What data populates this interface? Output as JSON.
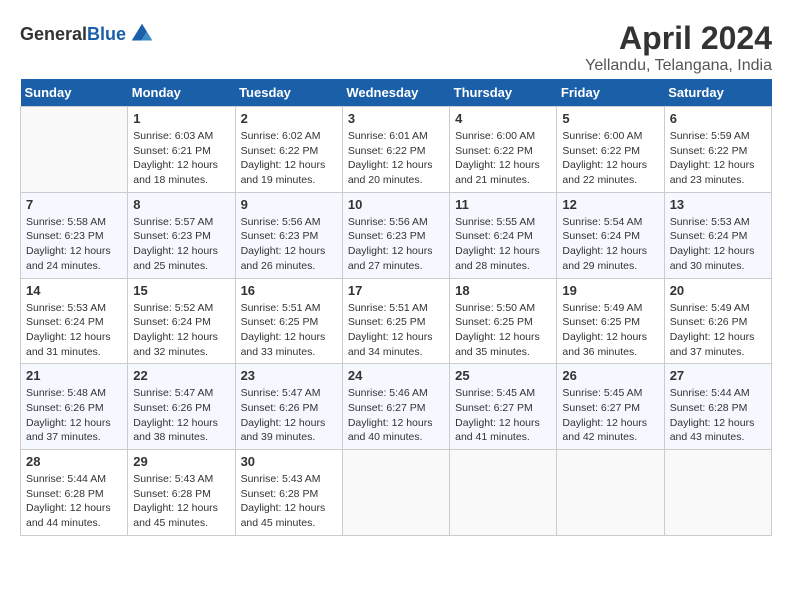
{
  "header": {
    "logo_general": "General",
    "logo_blue": "Blue",
    "month_title": "April 2024",
    "location": "Yellandu, Telangana, India"
  },
  "days_of_week": [
    "Sunday",
    "Monday",
    "Tuesday",
    "Wednesday",
    "Thursday",
    "Friday",
    "Saturday"
  ],
  "weeks": [
    [
      {
        "day": "",
        "empty": true
      },
      {
        "day": "1",
        "sunrise": "Sunrise: 6:03 AM",
        "sunset": "Sunset: 6:21 PM",
        "daylight": "Daylight: 12 hours and 18 minutes."
      },
      {
        "day": "2",
        "sunrise": "Sunrise: 6:02 AM",
        "sunset": "Sunset: 6:22 PM",
        "daylight": "Daylight: 12 hours and 19 minutes."
      },
      {
        "day": "3",
        "sunrise": "Sunrise: 6:01 AM",
        "sunset": "Sunset: 6:22 PM",
        "daylight": "Daylight: 12 hours and 20 minutes."
      },
      {
        "day": "4",
        "sunrise": "Sunrise: 6:00 AM",
        "sunset": "Sunset: 6:22 PM",
        "daylight": "Daylight: 12 hours and 21 minutes."
      },
      {
        "day": "5",
        "sunrise": "Sunrise: 6:00 AM",
        "sunset": "Sunset: 6:22 PM",
        "daylight": "Daylight: 12 hours and 22 minutes."
      },
      {
        "day": "6",
        "sunrise": "Sunrise: 5:59 AM",
        "sunset": "Sunset: 6:22 PM",
        "daylight": "Daylight: 12 hours and 23 minutes."
      }
    ],
    [
      {
        "day": "7",
        "sunrise": "Sunrise: 5:58 AM",
        "sunset": "Sunset: 6:23 PM",
        "daylight": "Daylight: 12 hours and 24 minutes."
      },
      {
        "day": "8",
        "sunrise": "Sunrise: 5:57 AM",
        "sunset": "Sunset: 6:23 PM",
        "daylight": "Daylight: 12 hours and 25 minutes."
      },
      {
        "day": "9",
        "sunrise": "Sunrise: 5:56 AM",
        "sunset": "Sunset: 6:23 PM",
        "daylight": "Daylight: 12 hours and 26 minutes."
      },
      {
        "day": "10",
        "sunrise": "Sunrise: 5:56 AM",
        "sunset": "Sunset: 6:23 PM",
        "daylight": "Daylight: 12 hours and 27 minutes."
      },
      {
        "day": "11",
        "sunrise": "Sunrise: 5:55 AM",
        "sunset": "Sunset: 6:24 PM",
        "daylight": "Daylight: 12 hours and 28 minutes."
      },
      {
        "day": "12",
        "sunrise": "Sunrise: 5:54 AM",
        "sunset": "Sunset: 6:24 PM",
        "daylight": "Daylight: 12 hours and 29 minutes."
      },
      {
        "day": "13",
        "sunrise": "Sunrise: 5:53 AM",
        "sunset": "Sunset: 6:24 PM",
        "daylight": "Daylight: 12 hours and 30 minutes."
      }
    ],
    [
      {
        "day": "14",
        "sunrise": "Sunrise: 5:53 AM",
        "sunset": "Sunset: 6:24 PM",
        "daylight": "Daylight: 12 hours and 31 minutes."
      },
      {
        "day": "15",
        "sunrise": "Sunrise: 5:52 AM",
        "sunset": "Sunset: 6:24 PM",
        "daylight": "Daylight: 12 hours and 32 minutes."
      },
      {
        "day": "16",
        "sunrise": "Sunrise: 5:51 AM",
        "sunset": "Sunset: 6:25 PM",
        "daylight": "Daylight: 12 hours and 33 minutes."
      },
      {
        "day": "17",
        "sunrise": "Sunrise: 5:51 AM",
        "sunset": "Sunset: 6:25 PM",
        "daylight": "Daylight: 12 hours and 34 minutes."
      },
      {
        "day": "18",
        "sunrise": "Sunrise: 5:50 AM",
        "sunset": "Sunset: 6:25 PM",
        "daylight": "Daylight: 12 hours and 35 minutes."
      },
      {
        "day": "19",
        "sunrise": "Sunrise: 5:49 AM",
        "sunset": "Sunset: 6:25 PM",
        "daylight": "Daylight: 12 hours and 36 minutes."
      },
      {
        "day": "20",
        "sunrise": "Sunrise: 5:49 AM",
        "sunset": "Sunset: 6:26 PM",
        "daylight": "Daylight: 12 hours and 37 minutes."
      }
    ],
    [
      {
        "day": "21",
        "sunrise": "Sunrise: 5:48 AM",
        "sunset": "Sunset: 6:26 PM",
        "daylight": "Daylight: 12 hours and 37 minutes."
      },
      {
        "day": "22",
        "sunrise": "Sunrise: 5:47 AM",
        "sunset": "Sunset: 6:26 PM",
        "daylight": "Daylight: 12 hours and 38 minutes."
      },
      {
        "day": "23",
        "sunrise": "Sunrise: 5:47 AM",
        "sunset": "Sunset: 6:26 PM",
        "daylight": "Daylight: 12 hours and 39 minutes."
      },
      {
        "day": "24",
        "sunrise": "Sunrise: 5:46 AM",
        "sunset": "Sunset: 6:27 PM",
        "daylight": "Daylight: 12 hours and 40 minutes."
      },
      {
        "day": "25",
        "sunrise": "Sunrise: 5:45 AM",
        "sunset": "Sunset: 6:27 PM",
        "daylight": "Daylight: 12 hours and 41 minutes."
      },
      {
        "day": "26",
        "sunrise": "Sunrise: 5:45 AM",
        "sunset": "Sunset: 6:27 PM",
        "daylight": "Daylight: 12 hours and 42 minutes."
      },
      {
        "day": "27",
        "sunrise": "Sunrise: 5:44 AM",
        "sunset": "Sunset: 6:28 PM",
        "daylight": "Daylight: 12 hours and 43 minutes."
      }
    ],
    [
      {
        "day": "28",
        "sunrise": "Sunrise: 5:44 AM",
        "sunset": "Sunset: 6:28 PM",
        "daylight": "Daylight: 12 hours and 44 minutes."
      },
      {
        "day": "29",
        "sunrise": "Sunrise: 5:43 AM",
        "sunset": "Sunset: 6:28 PM",
        "daylight": "Daylight: 12 hours and 45 minutes."
      },
      {
        "day": "30",
        "sunrise": "Sunrise: 5:43 AM",
        "sunset": "Sunset: 6:28 PM",
        "daylight": "Daylight: 12 hours and 45 minutes."
      },
      {
        "day": "",
        "empty": true
      },
      {
        "day": "",
        "empty": true
      },
      {
        "day": "",
        "empty": true
      },
      {
        "day": "",
        "empty": true
      }
    ]
  ]
}
